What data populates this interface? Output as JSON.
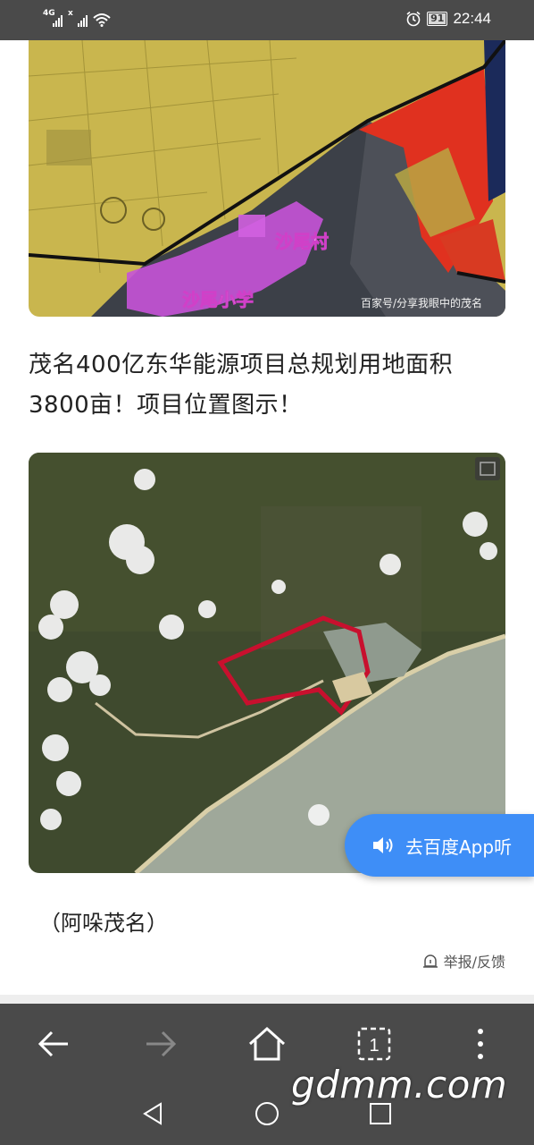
{
  "status_bar": {
    "signal1_tag": "4G",
    "signal2_tag": "x",
    "battery": "91",
    "time": "22:44"
  },
  "image1": {
    "label_village": "沙尾村",
    "label_school": "沙尾小学",
    "source": "百家号/分享我眼中的茂名"
  },
  "article": {
    "headline": "茂名400亿东华能源项目总规划用地面积3800亩！项目位置图示！",
    "caption": "（阿哚茂名）",
    "report_label": "举报/反馈"
  },
  "listen_button": {
    "label": "去百度App听"
  },
  "browser_bar": {
    "tab_count": "1",
    "icons": [
      "back-arrow-icon",
      "forward-arrow-icon",
      "home-icon",
      "tabs-icon",
      "more-icon"
    ]
  },
  "nav_bar": {
    "icons": [
      "back-triangle-icon",
      "home-circle-icon",
      "recents-square-icon"
    ]
  },
  "watermark": "gdmm.com",
  "colors": {
    "status_bar": "#4a4a4a",
    "accent_blue": "#3e8ef7",
    "boundary_red": "#c8102e"
  }
}
